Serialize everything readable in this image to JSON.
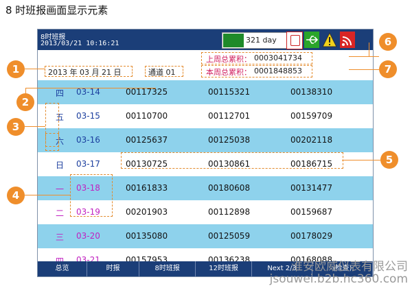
{
  "caption": "8 时班报画面显示元素",
  "screen": {
    "title": "8时班报",
    "datetime": "2013/03/21 10:16:21",
    "day_counter": "321 day",
    "totals": [
      {
        "label": "上周总累积：",
        "value": "0003041734"
      },
      {
        "label": "本周总累积：",
        "value": "0001848853"
      }
    ],
    "date_display": "2013 年 03 月 21 日",
    "channel": "通道 01",
    "rows": [
      {
        "weekday": "四",
        "date": "03-14",
        "v1": "00117325",
        "v2": "00115321",
        "v3": "00138310",
        "bg": "blue",
        "day_color": "#1b3e9e"
      },
      {
        "weekday": "五",
        "date": "03-15",
        "v1": "00110700",
        "v2": "00112701",
        "v3": "00159709",
        "bg": "white",
        "day_color": "#1b3e9e"
      },
      {
        "weekday": "六",
        "date": "03-16",
        "v1": "00125637",
        "v2": "00125038",
        "v3": "00202118",
        "bg": "blue",
        "day_color": "#1b3e9e"
      },
      {
        "weekday": "日",
        "date": "03-17",
        "v1": "00130725",
        "v2": "00130861",
        "v3": "00186715",
        "bg": "white",
        "day_color": "#1b3e9e"
      },
      {
        "weekday": "一",
        "date": "03-18",
        "v1": "00161833",
        "v2": "00180608",
        "v3": "00131477",
        "bg": "blue",
        "day_color": "#c020c0"
      },
      {
        "weekday": "二",
        "date": "03-19",
        "v1": "00201903",
        "v2": "00112898",
        "v3": "00159687",
        "bg": "white",
        "day_color": "#c020c0"
      },
      {
        "weekday": "三",
        "date": "03-20",
        "v1": "00135080",
        "v2": "00125059",
        "v3": "00178029",
        "bg": "blue",
        "day_color": "#c020c0"
      },
      {
        "weekday": "四",
        "date": "03-21",
        "v1": "00157953",
        "v2": "00136238",
        "v3": "00168088",
        "bg": "white",
        "day_color": "#c020c0"
      }
    ],
    "footer_tabs": [
      "总览",
      "时报",
      "8时班报",
      "12时班报",
      "Next 2/3",
      "(检查)"
    ]
  },
  "callouts": [
    "1",
    "2",
    "3",
    "4",
    "5",
    "6",
    "7"
  ],
  "watermark_line1": "淮安欧威仪表有限公司",
  "watermark_line2": "jsouwei.b2b.hc360.com",
  "colors": {
    "accent": "#ef8e2b",
    "header": "#1b3e78",
    "row_blue": "#8ed2ec"
  },
  "icons": [
    "sd-card-icon",
    "usb-icon",
    "warning-icon",
    "wifi-icon"
  ]
}
